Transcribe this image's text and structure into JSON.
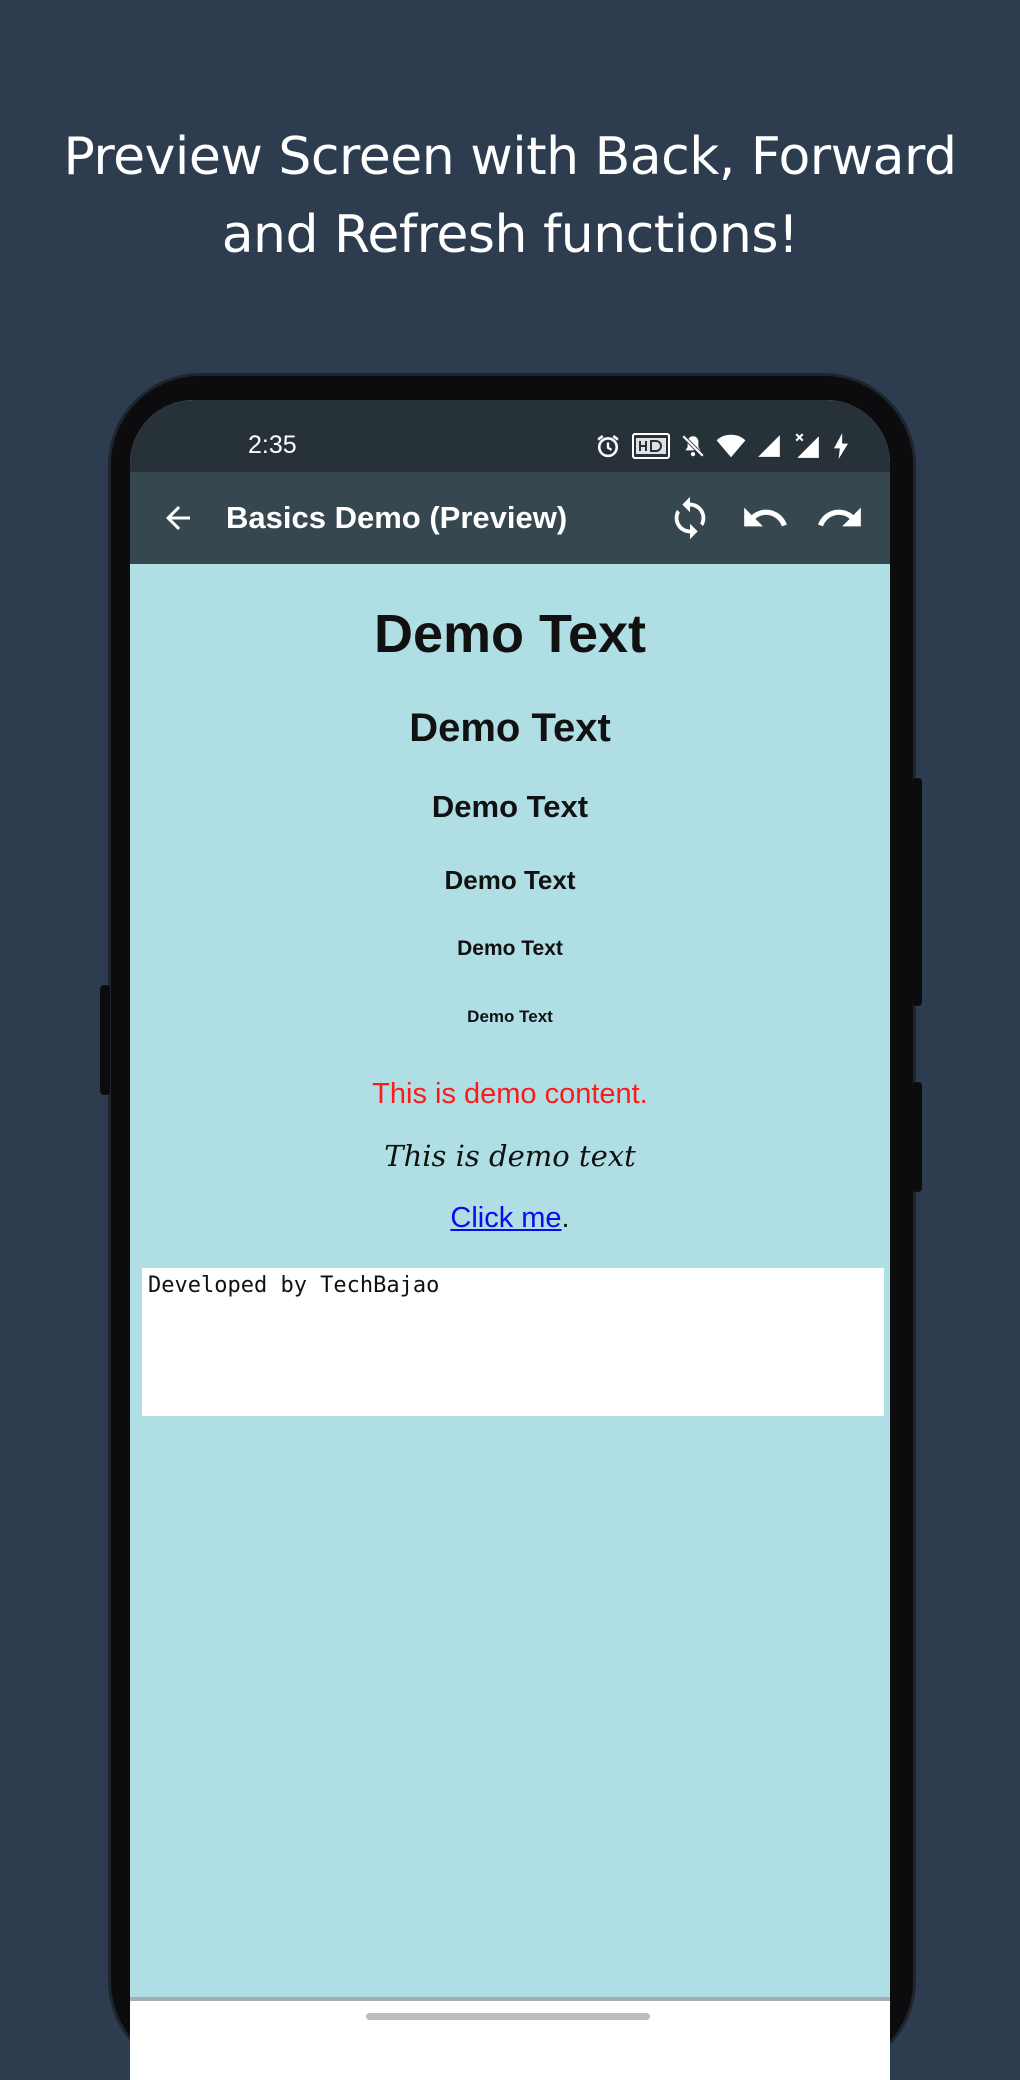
{
  "promo": {
    "line1": "Preview Screen with Back, Forward",
    "line2": "and Refresh functions!"
  },
  "status_bar": {
    "time": "2:35",
    "icons": [
      "alarm-icon",
      "hd-voice-icon",
      "mute-icon",
      "wifi-icon",
      "signal-icon",
      "signal-off-icon",
      "charging-icon"
    ]
  },
  "app_bar": {
    "back_icon": "arrow-left-icon",
    "title": "Basics Demo (Preview)",
    "actions": [
      {
        "name": "refresh",
        "icon": "refresh-icon"
      },
      {
        "name": "undo",
        "icon": "undo-icon"
      },
      {
        "name": "redo",
        "icon": "redo-icon"
      }
    ]
  },
  "preview": {
    "headings": [
      "Demo Text",
      "Demo Text",
      "Demo Text",
      "Demo Text",
      "Demo Text",
      "Demo Text"
    ],
    "red_text": "This is demo content.",
    "italic_text": "This is demo text",
    "link_text": "Click me",
    "link_suffix": ".",
    "code_text": "Developed by TechBajao",
    "background_color": "#b0dee5",
    "red_color": "#ff1a1a",
    "link_color": "#0b0bee"
  },
  "colors": {
    "page_background": "#2d3c4f",
    "status_bar": "#263238",
    "app_bar": "#37474f"
  }
}
